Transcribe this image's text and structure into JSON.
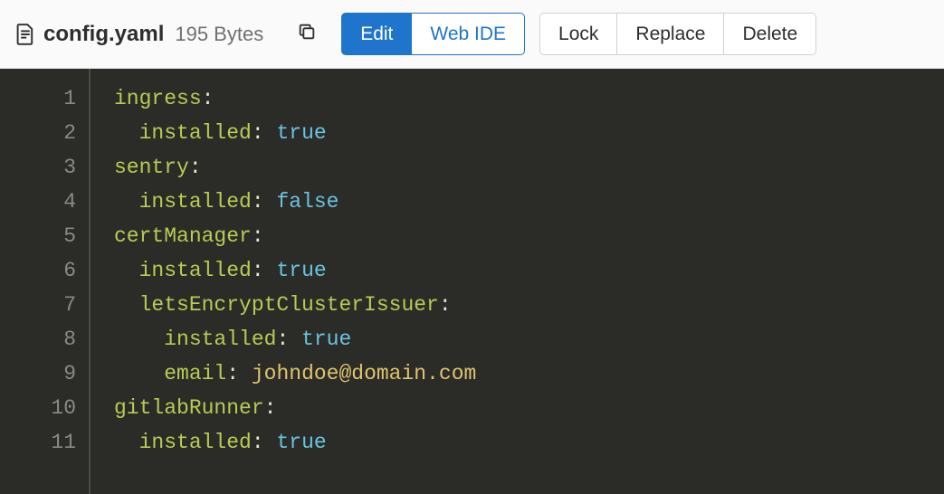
{
  "file": {
    "name": "config.yaml",
    "size": "195 Bytes"
  },
  "toolbar": {
    "edit_label": "Edit",
    "webide_label": "Web IDE",
    "lock_label": "Lock",
    "replace_label": "Replace",
    "delete_label": "Delete"
  },
  "code": {
    "lines": [
      {
        "n": "1",
        "indent": 0,
        "key": "ingress",
        "val": "",
        "valtype": ""
      },
      {
        "n": "2",
        "indent": 1,
        "key": "installed",
        "val": "true",
        "valtype": "bool"
      },
      {
        "n": "3",
        "indent": 0,
        "key": "sentry",
        "val": "",
        "valtype": ""
      },
      {
        "n": "4",
        "indent": 1,
        "key": "installed",
        "val": "false",
        "valtype": "bool"
      },
      {
        "n": "5",
        "indent": 0,
        "key": "certManager",
        "val": "",
        "valtype": ""
      },
      {
        "n": "6",
        "indent": 1,
        "key": "installed",
        "val": "true",
        "valtype": "bool"
      },
      {
        "n": "7",
        "indent": 1,
        "key": "letsEncryptClusterIssuer",
        "val": "",
        "valtype": ""
      },
      {
        "n": "8",
        "indent": 2,
        "key": "installed",
        "val": "true",
        "valtype": "bool"
      },
      {
        "n": "9",
        "indent": 2,
        "key": "email",
        "val": "johndoe@domain.com",
        "valtype": "str"
      },
      {
        "n": "10",
        "indent": 0,
        "key": "gitlabRunner",
        "val": "",
        "valtype": ""
      },
      {
        "n": "11",
        "indent": 1,
        "key": "installed",
        "val": "true",
        "valtype": "bool"
      }
    ]
  }
}
